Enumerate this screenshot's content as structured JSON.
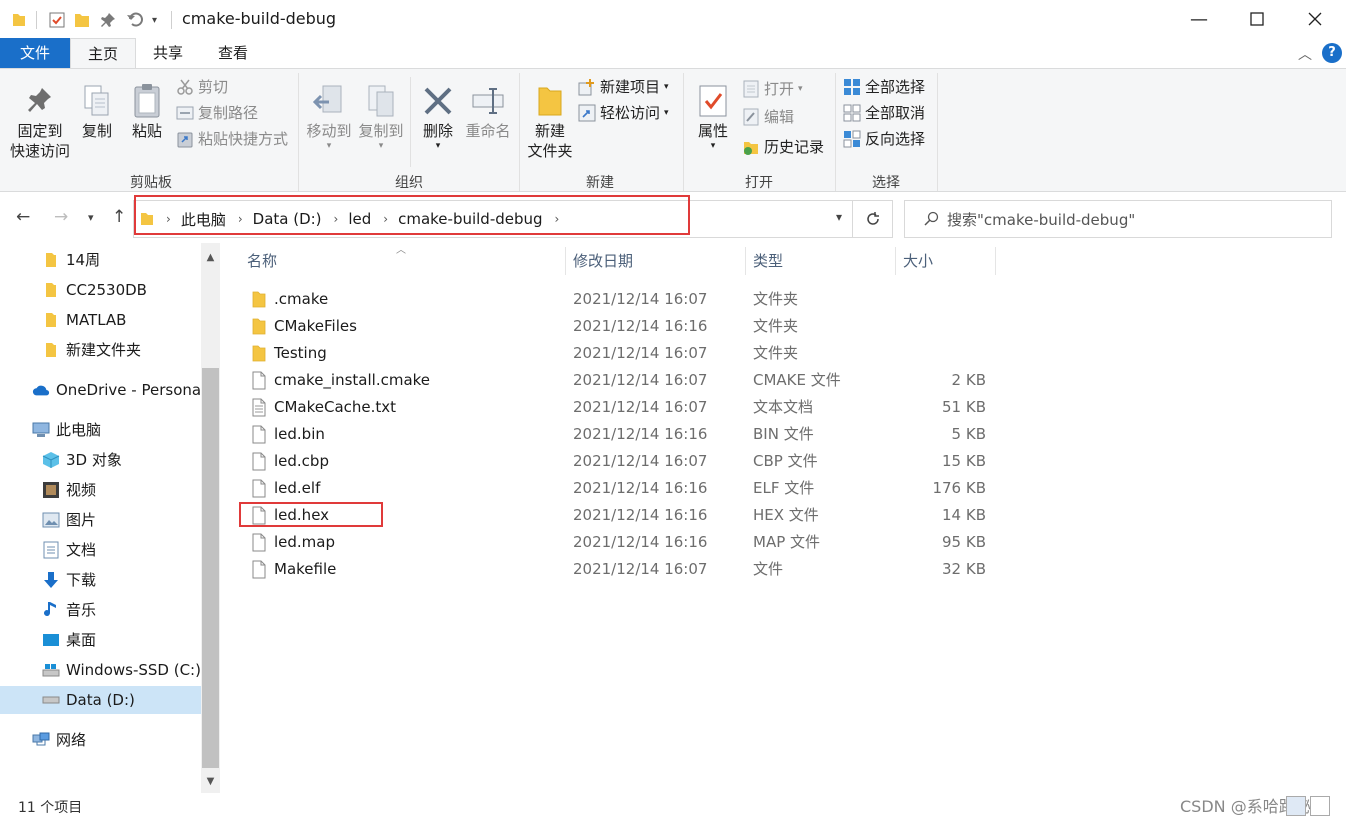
{
  "window": {
    "title": "cmake-build-debug"
  },
  "tabs": [
    {
      "label": "文件"
    },
    {
      "label": "主页"
    },
    {
      "label": "共享"
    },
    {
      "label": "查看"
    }
  ],
  "ribbon": {
    "clipboard": {
      "label": "剪贴板",
      "pin_line1": "固定到",
      "pin_line2": "快速访问",
      "copy": "复制",
      "paste": "粘贴",
      "cut": "剪切",
      "copy_path": "复制路径",
      "paste_shortcut": "粘贴快捷方式"
    },
    "organize": {
      "label": "组织",
      "move_to": "移动到",
      "copy_to": "复制到",
      "delete": "删除",
      "rename": "重命名"
    },
    "new": {
      "label": "新建",
      "new_folder_line1": "新建",
      "new_folder_line2": "文件夹",
      "new_item": "新建项目",
      "easy_access": "轻松访问"
    },
    "open": {
      "label": "打开",
      "properties": "属性",
      "open": "打开",
      "edit": "编辑",
      "history": "历史记录"
    },
    "select": {
      "label": "选择",
      "select_all": "全部选择",
      "select_none": "全部取消",
      "invert": "反向选择"
    }
  },
  "address": {
    "crumbs": [
      "此电脑",
      "Data (D:)",
      "led",
      "cmake-build-debug"
    ]
  },
  "search": {
    "placeholder": "搜索\"cmake-build-debug\""
  },
  "nav": {
    "items": [
      {
        "label": "14周",
        "icon": "folder-icon"
      },
      {
        "label": "CC2530DB",
        "icon": "folder-icon"
      },
      {
        "label": "MATLAB",
        "icon": "folder-icon"
      },
      {
        "label": "新建文件夹",
        "icon": "folder-icon"
      },
      {
        "label": "OneDrive - Personal",
        "icon": "cloud-icon"
      },
      {
        "label": "此电脑",
        "icon": "computer-icon"
      },
      {
        "label": "3D 对象",
        "icon": "cube-icon"
      },
      {
        "label": "视频",
        "icon": "video-icon"
      },
      {
        "label": "图片",
        "icon": "picture-icon"
      },
      {
        "label": "文档",
        "icon": "document-icon"
      },
      {
        "label": "下载",
        "icon": "download-icon"
      },
      {
        "label": "音乐",
        "icon": "music-icon"
      },
      {
        "label": "桌面",
        "icon": "desktop-icon"
      },
      {
        "label": "Windows-SSD (C:)",
        "icon": "drive-icon"
      },
      {
        "label": "Data (D:)",
        "icon": "drive-icon"
      },
      {
        "label": "网络",
        "icon": "network-icon"
      }
    ]
  },
  "columns": {
    "name": "名称",
    "date": "修改日期",
    "type": "类型",
    "size": "大小"
  },
  "files": [
    {
      "name": ".cmake",
      "date": "2021/12/14 16:07",
      "type": "文件夹",
      "size": "",
      "kind": "folder"
    },
    {
      "name": "CMakeFiles",
      "date": "2021/12/14 16:16",
      "type": "文件夹",
      "size": "",
      "kind": "folder"
    },
    {
      "name": "Testing",
      "date": "2021/12/14 16:07",
      "type": "文件夹",
      "size": "",
      "kind": "folder"
    },
    {
      "name": "cmake_install.cmake",
      "date": "2021/12/14 16:07",
      "type": "CMAKE 文件",
      "size": "2 KB",
      "kind": "file"
    },
    {
      "name": "CMakeCache.txt",
      "date": "2021/12/14 16:07",
      "type": "文本文档",
      "size": "51 KB",
      "kind": "text"
    },
    {
      "name": "led.bin",
      "date": "2021/12/14 16:16",
      "type": "BIN 文件",
      "size": "5 KB",
      "kind": "file"
    },
    {
      "name": "led.cbp",
      "date": "2021/12/14 16:07",
      "type": "CBP 文件",
      "size": "15 KB",
      "kind": "file"
    },
    {
      "name": "led.elf",
      "date": "2021/12/14 16:16",
      "type": "ELF 文件",
      "size": "176 KB",
      "kind": "file"
    },
    {
      "name": "led.hex",
      "date": "2021/12/14 16:16",
      "type": "HEX 文件",
      "size": "14 KB",
      "kind": "file"
    },
    {
      "name": "led.map",
      "date": "2021/12/14 16:16",
      "type": "MAP 文件",
      "size": "95 KB",
      "kind": "file"
    },
    {
      "name": "Makefile",
      "date": "2021/12/14 16:07",
      "type": "文件",
      "size": "32 KB",
      "kind": "file"
    }
  ],
  "status": {
    "count": "11 个项目"
  },
  "watermark": "CSDN @系哈路秘",
  "colors": {
    "accent": "#1a6fc9",
    "highlight": "#e03a3a",
    "selection": "#cce4f7",
    "folder": "#f4c542"
  }
}
